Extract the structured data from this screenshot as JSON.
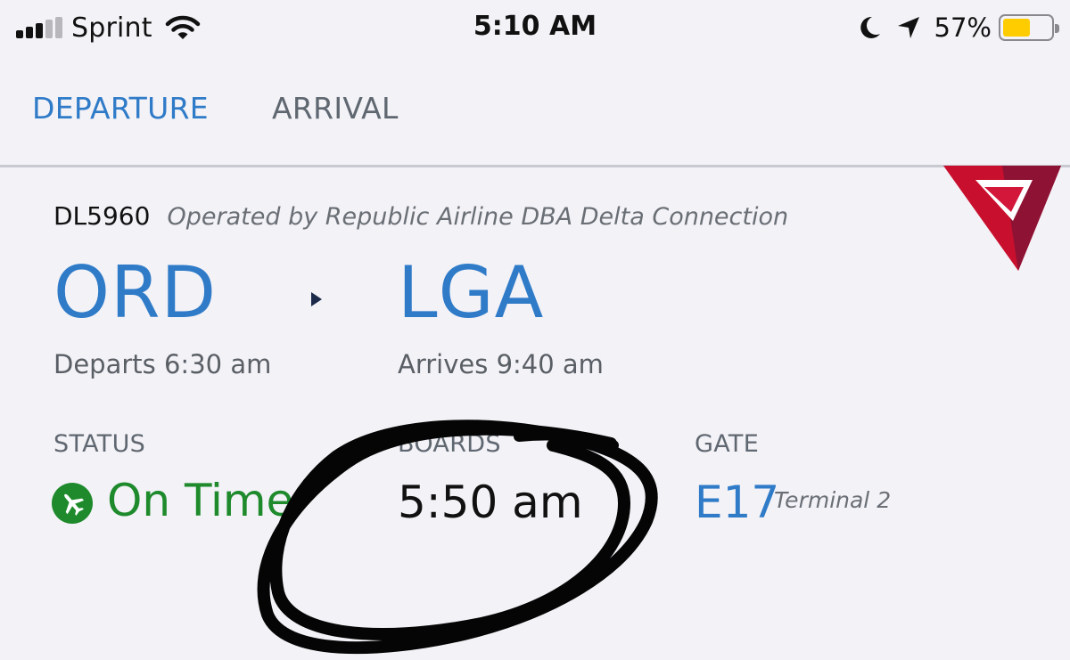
{
  "status_bar": {
    "carrier": "Sprint",
    "time": "5:10 AM",
    "battery_percent": "57%",
    "battery_level": 0.57,
    "signal_bars_filled": 3,
    "signal_bars_total": 5,
    "icons": [
      "signal-icon",
      "wifi-icon",
      "moon-icon",
      "location-arrow-icon",
      "battery-icon"
    ],
    "battery_color": "#ffcc00"
  },
  "tabs": [
    {
      "label": "DEPARTURE",
      "selected": true
    },
    {
      "label": "ARRIVAL",
      "selected": false
    }
  ],
  "flight": {
    "number": "DL5960",
    "operator": "Operated by Republic Airline DBA Delta Connection",
    "origin": "ORD",
    "destination": "LGA",
    "departs": "Departs 6:30 am",
    "arrives": "Arrives 9:40 am",
    "status_label": "STATUS",
    "status": "On Time",
    "boards_label": "BOARDS",
    "boards": "5:50 am",
    "gate_label": "GATE",
    "gate": "E17",
    "terminal": "Terminal 2"
  },
  "colors": {
    "accent_blue": "#2f7bc8",
    "status_green": "#1e8a2c",
    "logo_red": "#c8102e",
    "background": "#f3f2f7"
  }
}
